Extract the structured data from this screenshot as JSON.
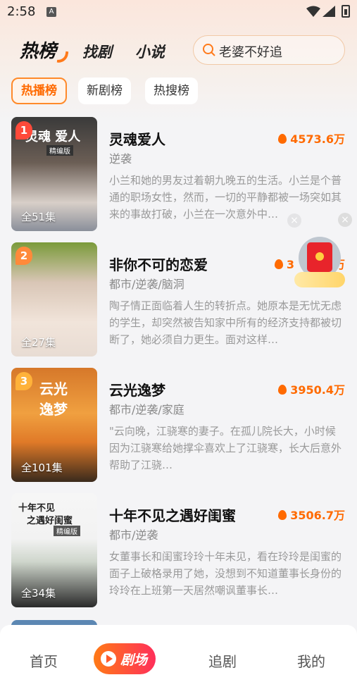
{
  "status_bar": {
    "time": "2:58",
    "sim_glyph": "A"
  },
  "header": {
    "tabs": [
      "热榜",
      "找剧",
      "小说"
    ],
    "search_placeholder": "老婆不好追"
  },
  "chips": [
    "热播榜",
    "新剧榜",
    "热搜榜"
  ],
  "dramas": [
    {
      "rank": "1",
      "title": "灵魂爱人",
      "heat": "4573.6万",
      "genre": "逆袭",
      "desc": "小兰和她的男友过着朝九晚五的生活。小兰是个普通的职场女性，然而，一切的平静都被一场突如其来的事故打破，小兰在一次意外中…",
      "episodes": "全51集",
      "poster_text": "灵魂 爱人",
      "poster_sub": "精编版"
    },
    {
      "rank": "2",
      "title": "非你不可的恋爱",
      "heat": "3",
      "genre": "都市/逆袭/脑洞",
      "desc": "陶子情正面临着人生的转折点。她原本是无忧无虑的学生，却突然被告知家中所有的经济支持都被切断了，她必须自力更生。面对这样…",
      "episodes": "全27集",
      "heat_suffix": "万"
    },
    {
      "rank": "3",
      "title": "云光逸梦",
      "heat": "3950.4万",
      "genre": "都市/逆袭/家庭",
      "desc": "\"云向晚，江骁寒的妻子。在孤儿院长大，小时候因为江骁寒给她撑伞喜欢上了江骁寒，长大后意外帮助了江骁…",
      "episodes": "全101集",
      "poster_text": "云光 逸梦"
    },
    {
      "rank": "",
      "title": "十年不见之遇好闺蜜",
      "heat": "3506.7万",
      "genre": "都市/逆袭",
      "desc": "女董事长和闺蜜玲玲十年未见，看在玲玲是闺蜜的面子上破格录用了她，没想到不知道董事长身份的玲玲在上班第一天居然嘲讽董事长…",
      "episodes": "全34集",
      "poster_text": "十年不见",
      "poster_text2": "之遇好闺蜜",
      "poster_sub": "精编版"
    }
  ],
  "floating": {
    "close_glyph": "×"
  },
  "bottom_nav": {
    "items": [
      "首页",
      "剧场",
      "追剧",
      "我的"
    ]
  },
  "colors": {
    "accent": "#ff6a00",
    "active_nav_start": "#ff7a16",
    "active_nav_end": "#ff2f5a"
  }
}
